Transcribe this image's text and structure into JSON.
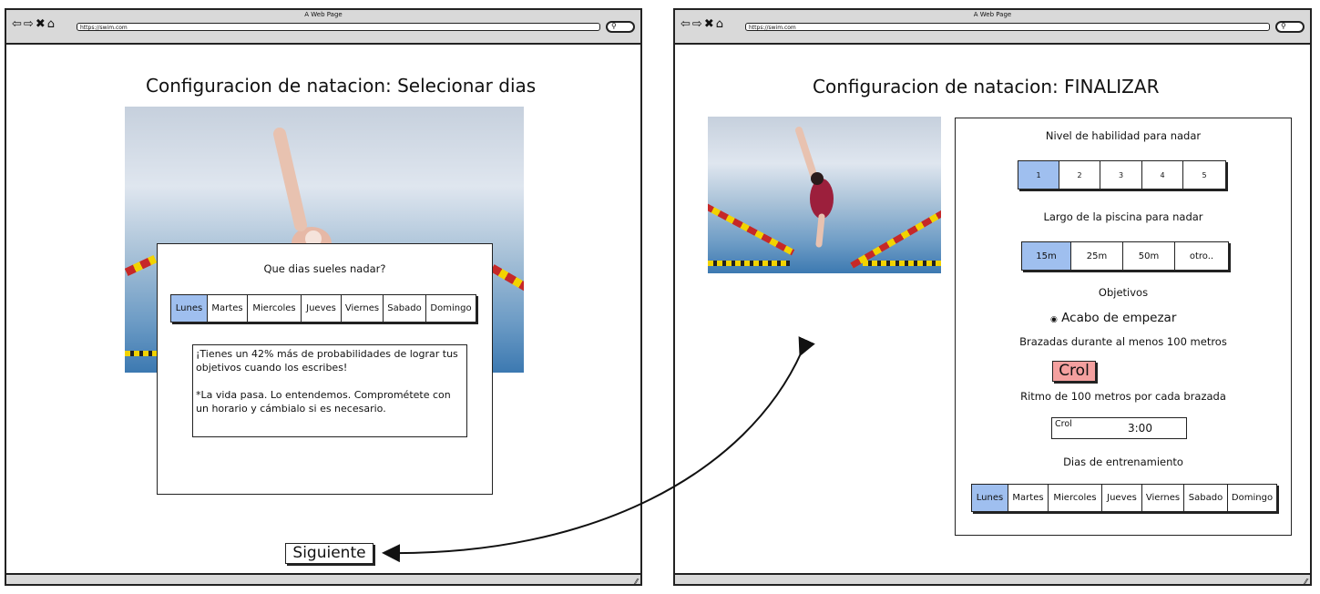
{
  "left_window": {
    "window_title": "A Web Page",
    "url": "https://swim.com",
    "page_title": "Configuracion de natacion: Selecionar dias",
    "dialog": {
      "question": "Que dias sueles nadar?",
      "days": [
        "Lunes",
        "Martes",
        "Miercoles",
        "Jueves",
        "Viernes",
        "Sabado",
        "Domingo"
      ],
      "selected_day": "Lunes",
      "note_line1": "¡Tienes un 42% más de probabilidades de lograr tus objetivos cuando los escribes!",
      "note_line2": "*La vida pasa. Lo entendemos. Comprométete con un horario y cámbialo si es necesario."
    },
    "next_button": "Siguiente"
  },
  "right_window": {
    "window_title": "A Web Page",
    "url": "https://swim.com",
    "page_title": "Configuracion de natacion: FINALIZAR",
    "summary": {
      "skill_label": "Nivel de habilidad para nadar",
      "skill_levels": [
        "1",
        "2",
        "3",
        "4",
        "5"
      ],
      "skill_selected": "1",
      "pool_label": "Largo de la piscina para nadar",
      "pool_options": [
        "15m",
        "25m",
        "50m",
        "otro.."
      ],
      "pool_selected": "15m",
      "goals_label": "Objetivos",
      "goal_option": "Acabo de empezar",
      "strokes_label": "Brazadas durante al menos 100 metros",
      "stroke_value": "Crol",
      "pace_label": "Ritmo de 100 metros por cada brazada",
      "pace_stroke": "Crol",
      "pace_time": "3:00",
      "days_label": "Dias de entrenamiento",
      "days": [
        "Lunes",
        "Martes",
        "Miercoles",
        "Jueves",
        "Viernes",
        "Sabado",
        "Domingo"
      ],
      "selected_day": "Lunes"
    }
  },
  "icons": {
    "back": "back-arrow-icon",
    "forward": "forward-arrow-icon",
    "close": "close-icon",
    "home": "home-icon",
    "search": "search-icon",
    "resize": "resize-grip-icon"
  },
  "colors": {
    "selected": "#9fbfef",
    "crol_highlight": "#f4a09f",
    "chrome": "#d9d9d9"
  }
}
